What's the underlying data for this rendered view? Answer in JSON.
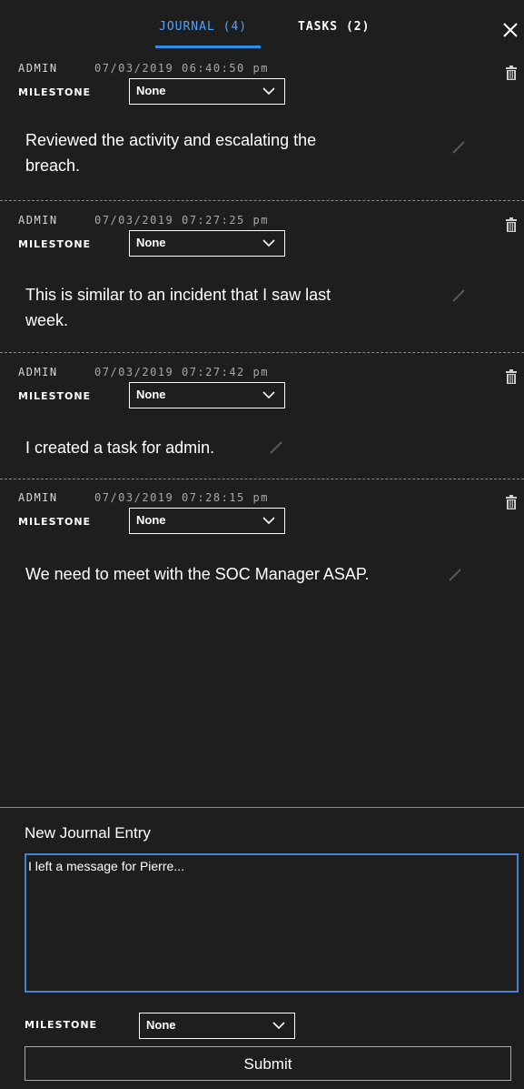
{
  "tabs": [
    {
      "label": "JOURNAL (4)",
      "active": true
    },
    {
      "label": "TASKS (2)",
      "active": false
    }
  ],
  "icons": {
    "close": "close-icon",
    "delete": "trash-icon",
    "edit": "pencil-icon",
    "dropdown": "chevron-down-icon"
  },
  "entries": [
    {
      "author": "ADMIN",
      "timestamp": "07/03/2019 06:40:50 pm",
      "milestone_label": "MILESTONE",
      "milestone_value": "None",
      "text_lines": [
        "Reviewed the activity and escalating the",
        "breach."
      ]
    },
    {
      "author": "ADMIN",
      "timestamp": "07/03/2019 07:27:25 pm",
      "milestone_label": "MILESTONE",
      "milestone_value": "None",
      "text_lines": [
        "This is similar to an incident that I saw last",
        "week."
      ]
    },
    {
      "author": "ADMIN",
      "timestamp": "07/03/2019 07:27:42 pm",
      "milestone_label": "MILESTONE",
      "milestone_value": "None",
      "text_lines": [
        "I created a task for admin."
      ]
    },
    {
      "author": "ADMIN",
      "timestamp": "07/03/2019 07:28:15 pm",
      "milestone_label": "MILESTONE",
      "milestone_value": "None",
      "text_lines": [
        "We need to meet with the SOC Manager ASAP."
      ]
    }
  ],
  "new_entry": {
    "label": "New Journal Entry",
    "value": "I left a message for Pierre...",
    "milestone_label": "MILESTONE",
    "milestone_value": "None",
    "submit_label": "Submit"
  },
  "colors": {
    "background": "#1e1e1e",
    "active_tab": "#4fa3ff",
    "textarea_border": "#4a7fd4"
  }
}
